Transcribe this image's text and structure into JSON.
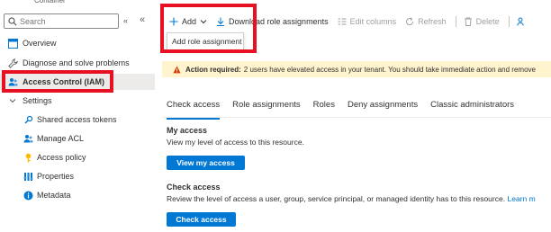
{
  "breadcrumb": {
    "resource_type": "Container"
  },
  "sidebar": {
    "search_placeholder": "Search",
    "collapse_x": "«",
    "collapse_chev": "«",
    "items": [
      {
        "label": "Overview",
        "icon": "overview-icon"
      },
      {
        "label": "Diagnose and solve problems",
        "icon": "wrench-icon"
      },
      {
        "label": "Access Control (IAM)",
        "icon": "people-icon"
      },
      {
        "label": "Settings",
        "icon": "chevron-down-icon"
      },
      {
        "label": "Shared access tokens",
        "icon": "key-link-icon"
      },
      {
        "label": "Manage ACL",
        "icon": "people-icon"
      },
      {
        "label": "Access policy",
        "icon": "key-icon"
      },
      {
        "label": "Properties",
        "icon": "properties-icon"
      },
      {
        "label": "Metadata",
        "icon": "info-icon"
      }
    ]
  },
  "toolbar": {
    "add_label": "Add",
    "download_label": "Download role assignments",
    "edit_columns_label": "Edit columns",
    "refresh_label": "Refresh",
    "delete_label": "Delete"
  },
  "add_menu": {
    "items": [
      "Add role assignment"
    ]
  },
  "banner": {
    "strong": "Action required:",
    "text": "2 users have elevated access in your tenant. You should take immediate action and remove"
  },
  "tabs": [
    "Check access",
    "Role assignments",
    "Roles",
    "Deny assignments",
    "Classic administrators"
  ],
  "my_access": {
    "title": "My access",
    "description": "View my level of access to this resource.",
    "button": "View my access"
  },
  "check_access": {
    "title": "Check access",
    "description": "Review the level of access a user, group, service principal, or managed identity has to this resource.",
    "link": "Learn m",
    "button": "Check access"
  },
  "colors": {
    "accent": "#0078d4",
    "highlight": "#e81123",
    "warning_bg": "#fff4ce",
    "warning_icon": "#d83b01"
  }
}
